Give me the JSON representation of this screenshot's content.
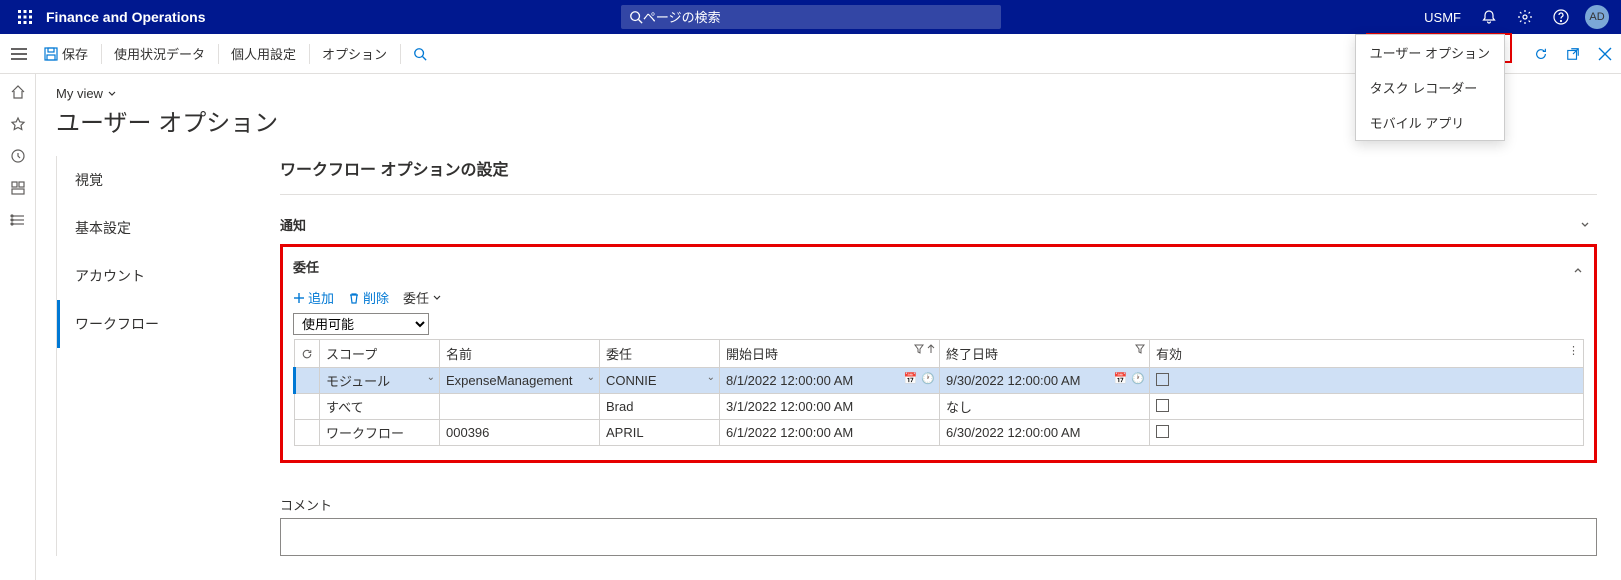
{
  "topbar": {
    "app_name": "Finance and Operations",
    "search_placeholder": "ページの検索",
    "entity": "USMF",
    "avatar": "AD"
  },
  "settings_menu": {
    "items": [
      "ユーザー オプション",
      "タスク レコーダー",
      "モバイル アプリ"
    ]
  },
  "actionbar": {
    "save": "保存",
    "usage": "使用状況データ",
    "personalize": "個人用設定",
    "options": "オプション"
  },
  "breadcrumb": {
    "view": "My view"
  },
  "page_title": "ユーザー オプション",
  "sidenav": {
    "items": [
      {
        "label": "視覚",
        "active": false
      },
      {
        "label": "基本設定",
        "active": false
      },
      {
        "label": "アカウント",
        "active": false
      },
      {
        "label": "ワークフロー",
        "active": true
      }
    ]
  },
  "form": {
    "section_title": "ワークフロー オプションの設定",
    "notifications": "通知",
    "delegation": "委任",
    "actions": {
      "add": "追加",
      "delete": "削除",
      "delegate": "委任"
    },
    "filter_value": "使用可能",
    "columns": {
      "scope": "スコープ",
      "name": "名前",
      "delegate": "委任",
      "start": "開始日時",
      "end": "終了日時",
      "enabled": "有効"
    },
    "rows": [
      {
        "scope": "モジュール",
        "name": "ExpenseManagement",
        "delegate": "CONNIE",
        "start": "8/1/2022 12:00:00 AM",
        "end": "9/30/2022 12:00:00 AM",
        "enabled": false,
        "selected": true,
        "show_dd": true
      },
      {
        "scope": "すべて",
        "name": "",
        "delegate": "Brad",
        "start": "3/1/2022 12:00:00 AM",
        "end": "なし",
        "enabled": false,
        "selected": false,
        "show_dd": false
      },
      {
        "scope": "ワークフロー",
        "name": "000396",
        "delegate": "APRIL",
        "start": "6/1/2022 12:00:00 AM",
        "end": "6/30/2022 12:00:00 AM",
        "enabled": false,
        "selected": false,
        "show_dd": false
      }
    ],
    "comment_label": "コメント"
  }
}
